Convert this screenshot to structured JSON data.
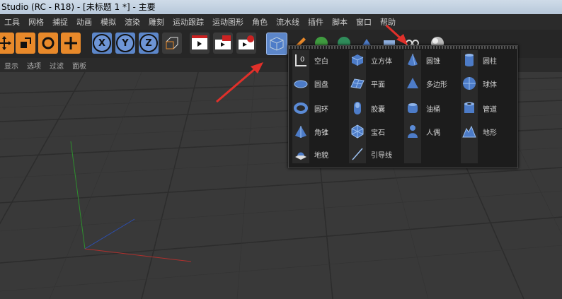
{
  "window": {
    "title": "Studio (RC - R18) - [未标题 1 *] - 主要"
  },
  "menubar": {
    "items": [
      "工具",
      "网格",
      "捕捉",
      "动画",
      "模拟",
      "渲染",
      "雕刻",
      "运动跟踪",
      "运动图形",
      "角色",
      "流水线",
      "插件",
      "脚本",
      "窗口",
      "帮助"
    ]
  },
  "toolbar": {
    "axis_x": "X",
    "axis_y": "Y",
    "axis_z": "Z"
  },
  "subbar": {
    "items": [
      "显示",
      "选项",
      "过滤",
      "面板"
    ]
  },
  "popup": {
    "col1": [
      {
        "label": "空白",
        "icon": "null-object-icon"
      },
      {
        "label": "圆盘",
        "icon": "disc-icon"
      },
      {
        "label": "圆环",
        "icon": "torus-icon"
      },
      {
        "label": "角锥",
        "icon": "pyramid-icon"
      },
      {
        "label": "地貌",
        "icon": "landscape-icon"
      }
    ],
    "col2": [
      {
        "label": "立方体",
        "icon": "cube-icon"
      },
      {
        "label": "平面",
        "icon": "plane-icon"
      },
      {
        "label": "胶囊",
        "icon": "capsule-icon"
      },
      {
        "label": "宝石",
        "icon": "platonic-icon"
      },
      {
        "label": "引导线",
        "icon": "guide-icon"
      }
    ],
    "col3": [
      {
        "label": "圆锥",
        "icon": "cone-icon"
      },
      {
        "label": "多边形",
        "icon": "polygon-icon"
      },
      {
        "label": "油桶",
        "icon": "oil-tank-icon"
      },
      {
        "label": "人偶",
        "icon": "figure-icon"
      }
    ],
    "col4": [
      {
        "label": "圆柱",
        "icon": "cylinder-icon"
      },
      {
        "label": "球体",
        "icon": "sphere-icon"
      },
      {
        "label": "管道",
        "icon": "tube-icon"
      },
      {
        "label": "地形",
        "icon": "relief-icon"
      }
    ]
  },
  "colors": {
    "accent_orange": "#e8892a",
    "accent_blue": "#5c86c9",
    "annotation_red": "#e0302a"
  }
}
